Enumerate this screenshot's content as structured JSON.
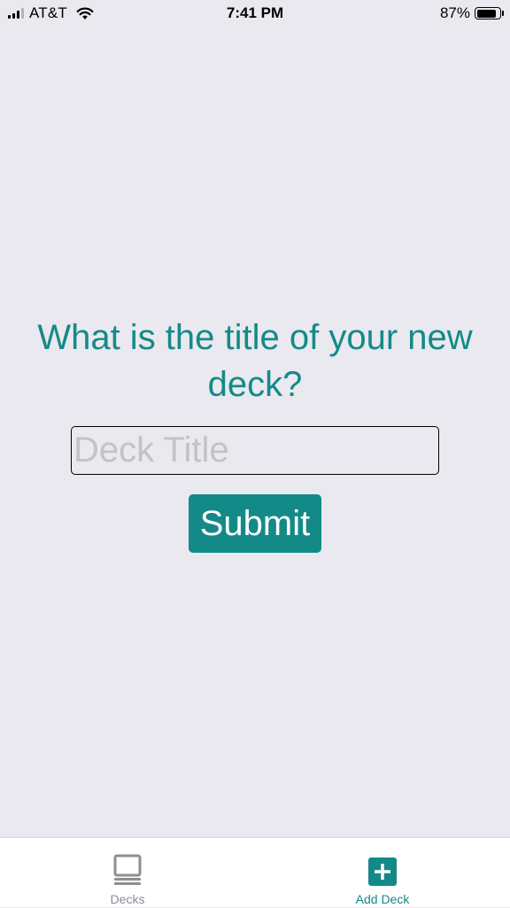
{
  "status_bar": {
    "carrier": "AT&T",
    "time": "7:41 PM",
    "battery_percent": "87%",
    "signal_bars": 4,
    "signal_bars_filled": 3,
    "battery_level": 0.87
  },
  "main": {
    "prompt": "What is the title of your new deck?",
    "input_placeholder": "Deck Title",
    "input_value": "",
    "submit_label": "Submit"
  },
  "tab_bar": {
    "tabs": [
      {
        "label": "Decks",
        "icon": "deck-stack-icon",
        "active": false
      },
      {
        "label": "Add Deck",
        "icon": "plus-square-icon",
        "active": true
      }
    ]
  },
  "colors": {
    "accent": "#148a88",
    "background": "#e9e9ef",
    "inactive_tab": "#8e8e93",
    "placeholder": "#c2c2c7"
  }
}
